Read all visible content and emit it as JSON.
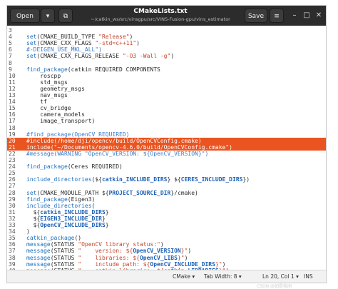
{
  "window": {
    "title": "CMakeLists.txt",
    "subtitle": "~/catkin_ws/src/vinsgpu/src/VINS-Fusion-gpu/vins_estimator",
    "open_label": "Open",
    "save_label": "Save"
  },
  "icons": {
    "open_arrow": "chevron-down-icon",
    "new_tab": "new-document-icon",
    "menu": "hamburger-menu-icon",
    "minimize": "minimize-icon",
    "maximize": "maximize-icon",
    "close": "close-icon"
  },
  "lines": [
    {
      "n": "3",
      "t": ""
    },
    {
      "n": "4",
      "t": "set(CMAKE_BUILD_TYPE \"Release\")"
    },
    {
      "n": "5",
      "t": "set(CMAKE_CXX_FLAGS \"-std=c++11\")"
    },
    {
      "n": "6",
      "t": "#-DEIGEN_USE_MKL_ALL\")"
    },
    {
      "n": "7",
      "t": "set(CMAKE_CXX_FLAGS_RELEASE \"-O3 -Wall -g\")"
    },
    {
      "n": "8",
      "t": ""
    },
    {
      "n": "9",
      "t": "find_package(catkin REQUIRED COMPONENTS"
    },
    {
      "n": "10",
      "t": "    roscpp"
    },
    {
      "n": "11",
      "t": "    std_msgs"
    },
    {
      "n": "12",
      "t": "    geometry_msgs"
    },
    {
      "n": "13",
      "t": "    nav_msgs"
    },
    {
      "n": "14",
      "t": "    tf"
    },
    {
      "n": "15",
      "t": "    cv_bridge"
    },
    {
      "n": "16",
      "t": "    camera_models"
    },
    {
      "n": "17",
      "t": "    image_transport)"
    },
    {
      "n": "18",
      "t": ""
    },
    {
      "n": "19",
      "t": "#find_package(OpenCV REQUIRED)"
    },
    {
      "n": "20",
      "t": "#include(/home/dji/opencv/build/OpenCVConfig.cmake)"
    },
    {
      "n": "21",
      "t": "include(\"~/Documents/opencv-4.6.0/build/OpenCVConfig.cmake\")"
    },
    {
      "n": "22",
      "t": "#message(WARNING \"OpenCV_VERSION: ${OpenCV_VERSION}\")"
    },
    {
      "n": "23",
      "t": ""
    },
    {
      "n": "24",
      "t": "find_package(Ceres REQUIRED)"
    },
    {
      "n": "25",
      "t": ""
    },
    {
      "n": "26",
      "t": "include_directories(${catkin_INCLUDE_DIRS} ${CERES_INCLUDE_DIRS})"
    },
    {
      "n": "27",
      "t": ""
    },
    {
      "n": "28",
      "t": "set(CMAKE_MODULE_PATH ${PROJECT_SOURCE_DIR}/cmake)"
    },
    {
      "n": "29",
      "t": "find_package(Eigen3)"
    },
    {
      "n": "30",
      "t": "include_directories("
    },
    {
      "n": "31",
      "t": "  ${catkin_INCLUDE_DIRS}"
    },
    {
      "n": "32",
      "t": "  ${EIGEN3_INCLUDE_DIR}"
    },
    {
      "n": "33",
      "t": "  ${OpenCV_INCLUDE_DIRS}"
    },
    {
      "n": "34",
      "t": ")"
    },
    {
      "n": "35",
      "t": "catkin_package()"
    },
    {
      "n": "36",
      "t": "message(STATUS \"OpenCV library status:\")"
    },
    {
      "n": "37",
      "t": "message(STATUS \"    version: ${OpenCV_VERSION}\")"
    },
    {
      "n": "38",
      "t": "message(STATUS \"    libraries: ${OpenCV_LIBS}\")"
    },
    {
      "n": "39",
      "t": "message(STATUS \"    include path: ${OpenCV_INCLUDE_DIRS}\")"
    },
    {
      "n": "40",
      "t": "message(STATUS \"    catkin libraries: ${catkin_LIBRARIES}\")"
    }
  ],
  "highlight_color": "#e95420",
  "status": {
    "language": "CMake ▾",
    "tab_width": "Tab Width: 8 ▾",
    "position": "Ln 20, Col 1 ▾",
    "mode": "INS"
  },
  "watermark": "CSDN @如是我闻"
}
